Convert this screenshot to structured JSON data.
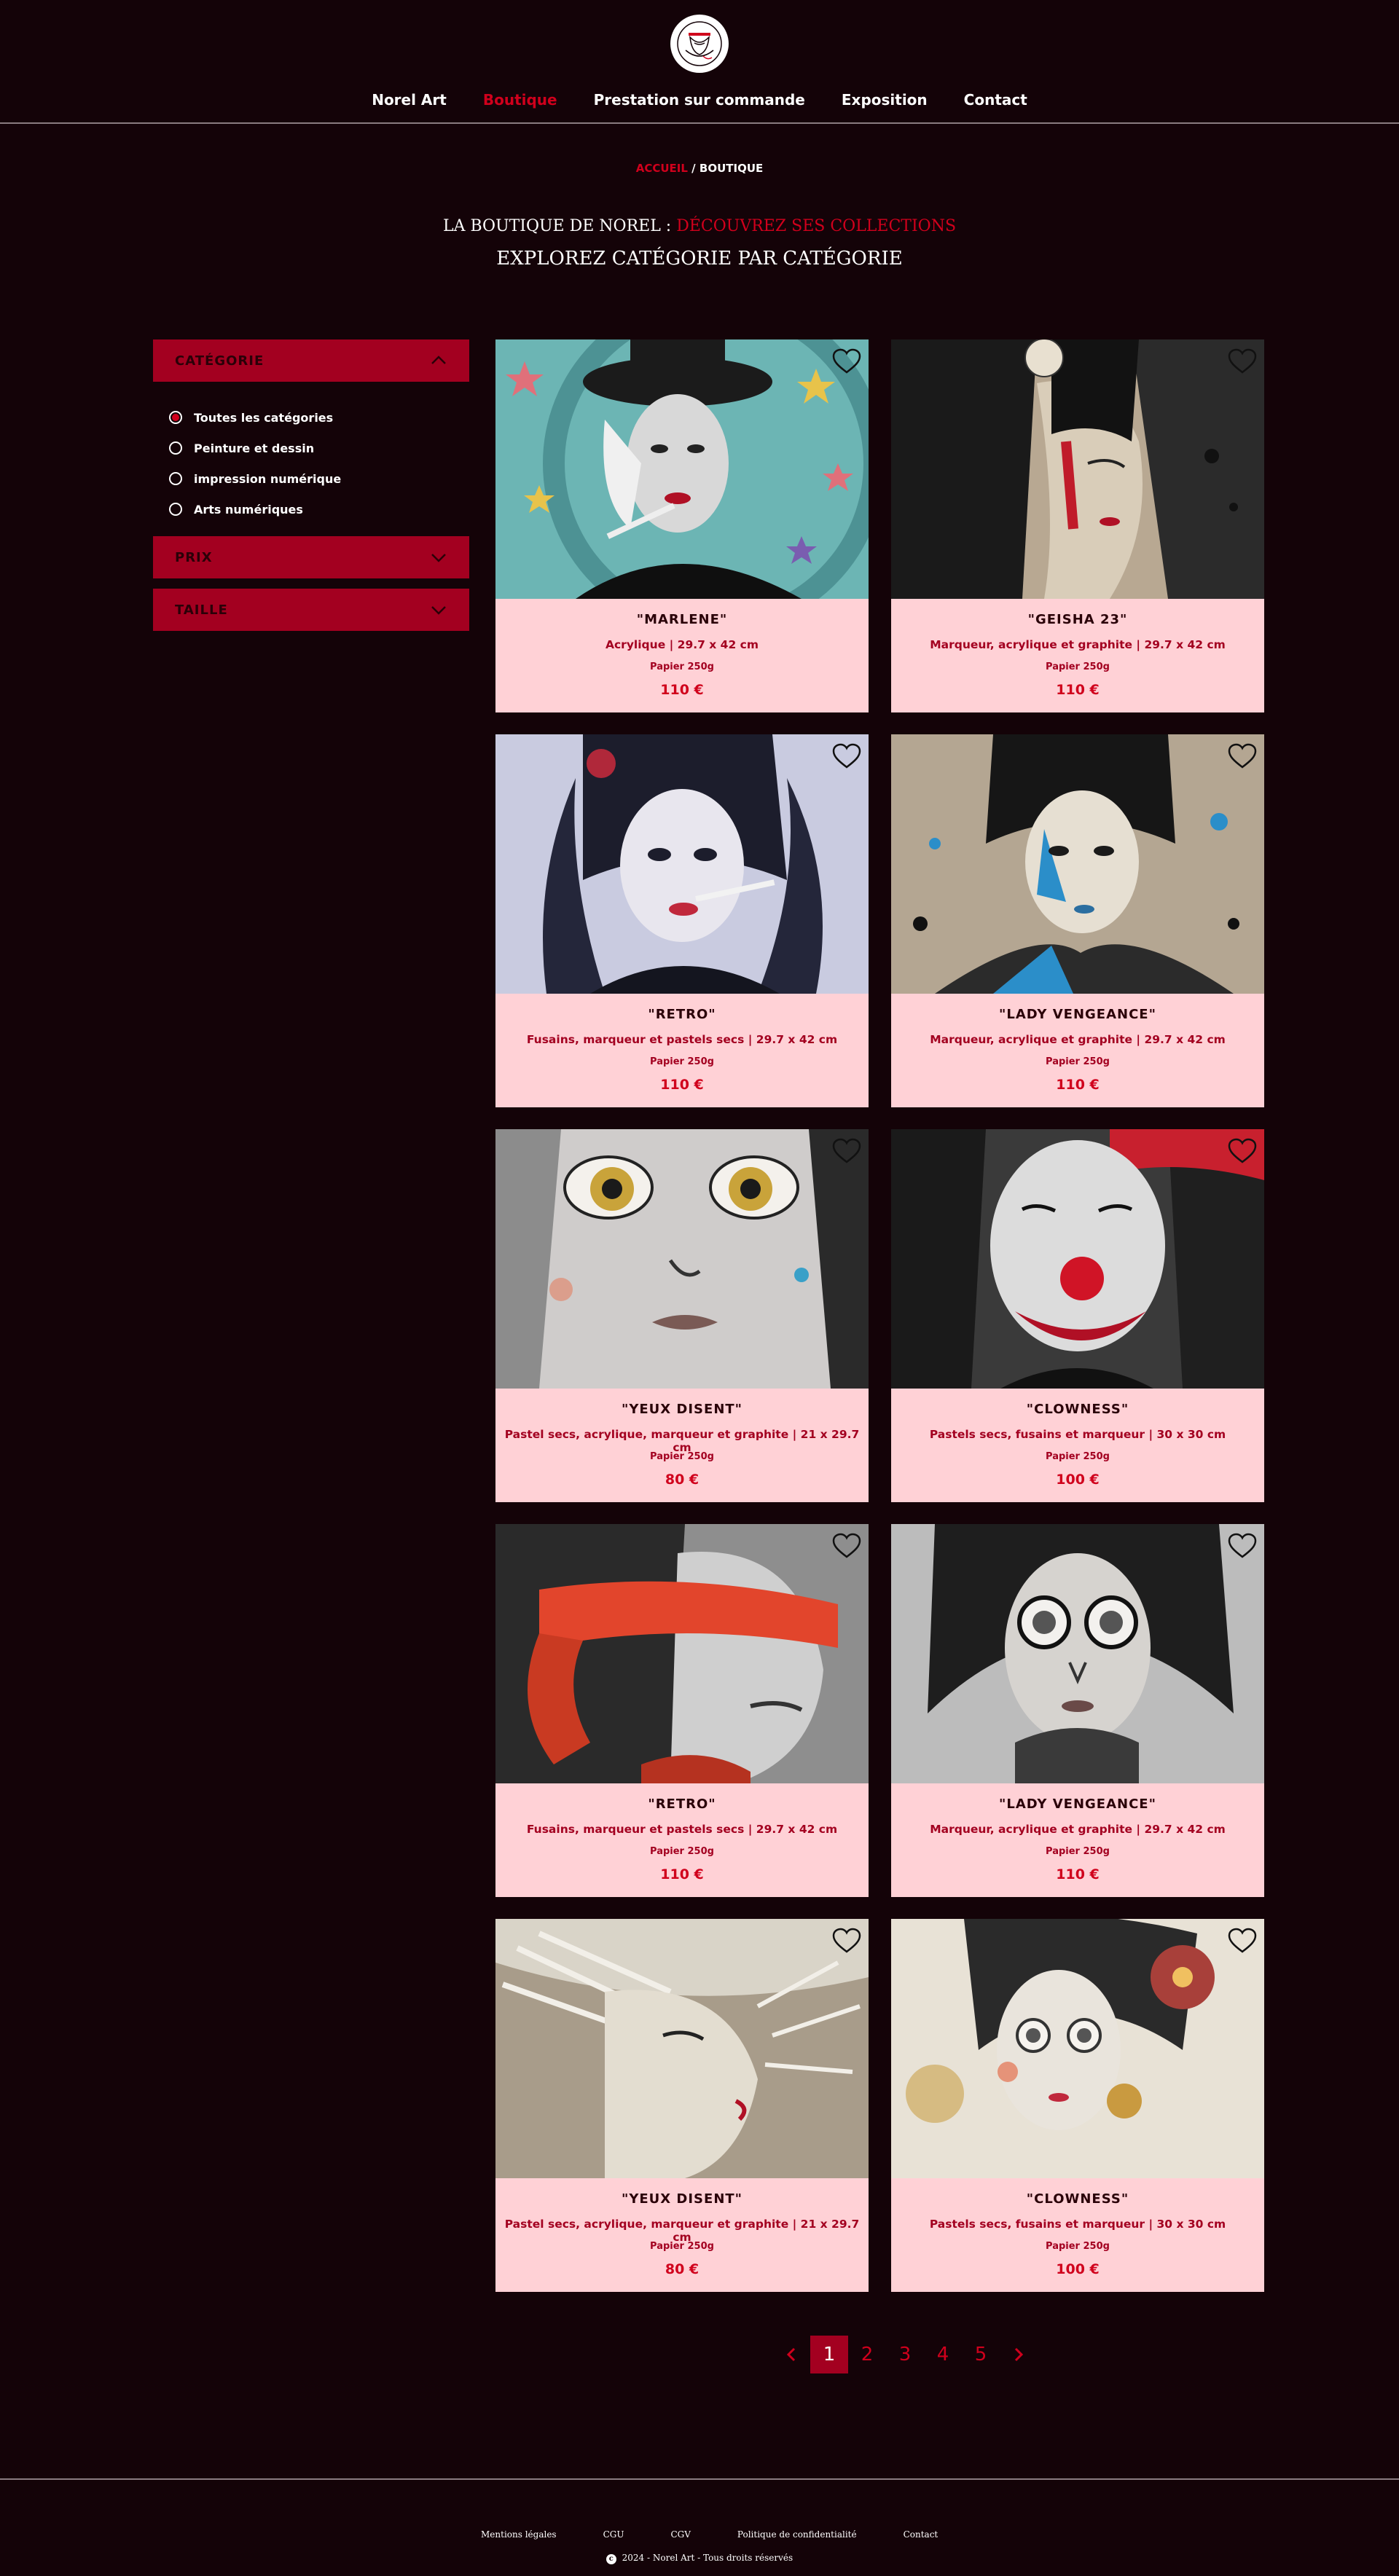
{
  "nav": {
    "items": [
      {
        "label": "Norel Art"
      },
      {
        "label": "Boutique"
      },
      {
        "label": "Prestation sur commande"
      },
      {
        "label": "Exposition"
      },
      {
        "label": "Contact"
      }
    ],
    "active": "Boutique",
    "accent": "#d0001c"
  },
  "breadcrumb": {
    "home": "ACCUEIL",
    "sep": "/",
    "current": "BOUTIQUE"
  },
  "titles": {
    "line1_a": "LA BOUTIQUE DE NOREL :",
    "line1_b": "DÉCOUVREZ SES COLLECTIONS",
    "line2": "EXPLOREZ CATÉGORIE PAR CATÉGORIE"
  },
  "filters": {
    "category": {
      "label": "CATÉGORIE",
      "expanded": true,
      "options": [
        "Toutes les catégories",
        "Peinture et dessin",
        "impression numérique",
        "Arts numériques"
      ],
      "selected": "Toutes les catégories"
    },
    "price": {
      "label": "PRIX",
      "expanded": false
    },
    "size": {
      "label": "TAILLE",
      "expanded": false
    }
  },
  "products": [
    {
      "name": "\"MARLENE\"",
      "technique": "Acrylique | 29.7 x 42 cm",
      "paper": "Papier 250g",
      "price": "110 €",
      "icon": "heart-outline"
    },
    {
      "name": "\"GEISHA 23\"",
      "technique": "Marqueur, acrylique et graphite | 29.7 x 42 cm",
      "paper": "Papier 250g",
      "price": "110 €",
      "icon": "heart-outline"
    },
    {
      "name": "\"RETRO\"",
      "technique": "Fusains, marqueur et pastels secs | 29.7 x 42 cm",
      "paper": "Papier 250g",
      "price": "110 €",
      "icon": "heart-outline"
    },
    {
      "name": "\"LADY VENGEANCE\"",
      "technique": "Marqueur, acrylique et graphite | 29.7 x 42 cm",
      "paper": "Papier 250g",
      "price": "110 €",
      "icon": "heart-outline"
    },
    {
      "name": "\"YEUX DISENT\"",
      "technique": "Pastel secs, acrylique, marqueur et graphite | 21 x 29.7 cm",
      "paper": "Papier 250g",
      "price": "80 €",
      "icon": "heart-outline"
    },
    {
      "name": "\"CLOWNESS\"",
      "technique": "Pastels secs, fusains et marqueur | 30 x 30 cm",
      "paper": "Papier 250g",
      "price": "100 €",
      "icon": "heart-outline"
    },
    {
      "name": "\"RETRO\"",
      "technique": "Fusains, marqueur et pastels secs | 29.7 x 42 cm",
      "paper": "Papier 250g",
      "price": "110 €",
      "icon": "heart-outline"
    },
    {
      "name": "\"LADY VENGEANCE\"",
      "technique": "Marqueur, acrylique et graphite | 29.7 x 42 cm",
      "paper": "Papier 250g",
      "price": "110 €",
      "icon": "heart-outline"
    },
    {
      "name": "\"YEUX DISENT\"",
      "technique": "Pastel secs, acrylique, marqueur et graphite | 21 x 29.7 cm",
      "paper": "Papier 250g",
      "price": "80 €",
      "icon": "heart-outline"
    },
    {
      "name": "\"CLOWNESS\"",
      "technique": "Pastels secs, fusains et marqueur | 30 x 30 cm",
      "paper": "Papier 250g",
      "price": "100 €",
      "icon": "heart-outline"
    }
  ],
  "pagination": {
    "pages": [
      "1",
      "2",
      "3",
      "4",
      "5"
    ],
    "current": "1"
  },
  "footer": {
    "links": [
      "Mentions légales",
      "CGU",
      "CGV",
      "Politique de confidentialité",
      "Contact"
    ],
    "copyright": "2024 - Norel Art - Tous droits réservés"
  },
  "colors": {
    "background": "#140308",
    "card": "#ffd1d6",
    "accent": "#d0001c",
    "filter": "#a30020"
  }
}
